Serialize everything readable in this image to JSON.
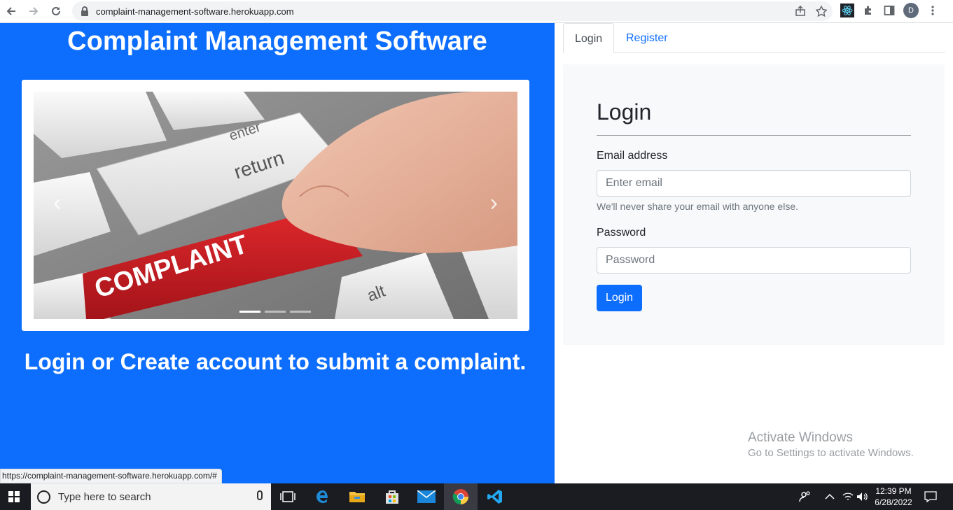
{
  "browser": {
    "url": "complaint-management-software.herokuapp.com",
    "avatar_letter": "D",
    "status_url": "https://complaint-management-software.herokuapp.com/#"
  },
  "left": {
    "title": "Complaint Management Software",
    "tagline": "Login or Create account to submit a complaint.",
    "carousel": {
      "slide_count": 3,
      "active_index": 0,
      "image_text": [
        "enter",
        "return",
        "COMPLAINT",
        "alt"
      ]
    }
  },
  "tabs": [
    {
      "label": "Login",
      "active": true
    },
    {
      "label": "Register",
      "active": false
    }
  ],
  "login": {
    "heading": "Login",
    "email_label": "Email address",
    "email_placeholder": "Enter email",
    "email_help": "We'll never share your email with anyone else.",
    "password_label": "Password",
    "password_placeholder": "Password",
    "submit_label": "Login"
  },
  "watermark": {
    "line1": "Activate Windows",
    "line2": "Go to Settings to activate Windows."
  },
  "taskbar": {
    "search_placeholder": "Type here to search",
    "time": "12:39 PM",
    "date": "6/28/2022",
    "apps": [
      "task-view",
      "edge",
      "file-explorer",
      "store",
      "mail",
      "chrome",
      "vscode"
    ]
  },
  "colors": {
    "primary": "#0d6efd",
    "card_bg": "#f8f9fa",
    "taskbar": "#1b1b22"
  }
}
